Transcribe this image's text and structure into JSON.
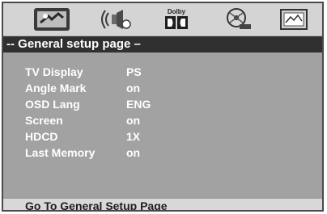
{
  "icon_bar": {
    "icons": [
      "general-setup-icon",
      "speaker-setup-icon",
      "dolby-digital-icon",
      "video-setup-icon",
      "preference-icon"
    ],
    "dolby_text": "Dolby"
  },
  "page_title": "-- General setup page –",
  "settings": [
    {
      "label": "TV Display",
      "value": "PS"
    },
    {
      "label": "Angle Mark",
      "value": "on"
    },
    {
      "label": "OSD Lang",
      "value": "ENG"
    },
    {
      "label": "Screen",
      "value": "on"
    },
    {
      "label": "HDCD",
      "value": "1X"
    },
    {
      "label": "Last Memory",
      "value": "on"
    }
  ],
  "status_text": "Go To General Setup Page"
}
